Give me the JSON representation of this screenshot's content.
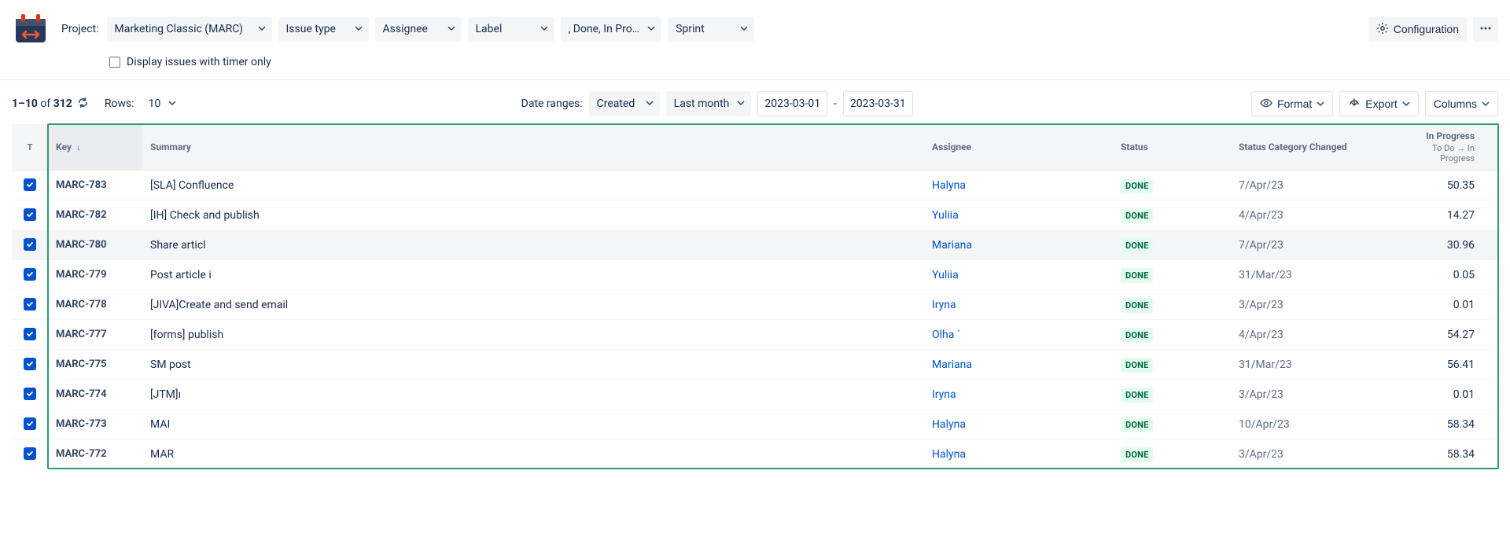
{
  "filters": {
    "project_label": "Project:",
    "project_value": "Marketing Classic (MARC)",
    "issue_type": "Issue type",
    "assignee": "Assignee",
    "label": "Label",
    "status_filter": ", Done, In Pro…",
    "sprint": "Sprint",
    "timer_only": "Display issues with timer only"
  },
  "actions": {
    "configuration": "Configuration"
  },
  "pagination": {
    "range": "1–10",
    "of_word": " of ",
    "total": "312",
    "rows_label": "Rows:",
    "rows_value": "10"
  },
  "date": {
    "ranges_label": "Date ranges:",
    "field": "Created",
    "preset": "Last month",
    "from": "2023-03-01",
    "sep": "-",
    "to": "2023-03-31"
  },
  "tools": {
    "format": "Format",
    "export": "Export",
    "columns": "Columns"
  },
  "headers": {
    "t": "T",
    "key": "Key",
    "summary": "Summary",
    "assignee": "Assignee",
    "status": "Status",
    "scc": "Status Category Changed",
    "inprog": "In Progress",
    "inprog_sub": "To Do → In Progress"
  },
  "rows": [
    {
      "key": "MARC-783",
      "summary": "[SLA] Confluence",
      "assignee": "Halyna",
      "status": "DONE",
      "scc": "7/Apr/23",
      "inprog": "50.35",
      "hovered": false
    },
    {
      "key": "MARC-782",
      "summary": "[IH] Check and publish",
      "assignee": "Yuliia",
      "status": "DONE",
      "scc": "4/Apr/23",
      "inprog": "14.27",
      "hovered": false
    },
    {
      "key": "MARC-780",
      "summary": "Share articl",
      "assignee": "Mariana",
      "status": "DONE",
      "scc": "7/Apr/23",
      "inprog": "30.96",
      "hovered": true
    },
    {
      "key": "MARC-779",
      "summary": "Post article i",
      "assignee": "Yuliia",
      "status": "DONE",
      "scc": "31/Mar/23",
      "inprog": "0.05",
      "hovered": false
    },
    {
      "key": "MARC-778",
      "summary": "[JIVA]Create and send email",
      "assignee": "Iryna",
      "status": "DONE",
      "scc": "3/Apr/23",
      "inprog": "0.01",
      "hovered": false
    },
    {
      "key": "MARC-777",
      "summary": "[forms] publish",
      "assignee": "Olha `",
      "status": "DONE",
      "scc": "4/Apr/23",
      "inprog": "54.27",
      "hovered": false
    },
    {
      "key": "MARC-775",
      "summary": "SM post",
      "assignee": "Mariana",
      "status": "DONE",
      "scc": "31/Mar/23",
      "inprog": "56.41",
      "hovered": false
    },
    {
      "key": "MARC-774",
      "summary": "[JTM]ı",
      "assignee": "Iryna",
      "status": "DONE",
      "scc": "3/Apr/23",
      "inprog": "0.01",
      "hovered": false
    },
    {
      "key": "MARC-773",
      "summary": "MAI",
      "assignee": "Halyna",
      "status": "DONE",
      "scc": "10/Apr/23",
      "inprog": "58.34",
      "hovered": false
    },
    {
      "key": "MARC-772",
      "summary": "MAR",
      "assignee": "Halyna",
      "status": "DONE",
      "scc": "3/Apr/23",
      "inprog": "58.34",
      "hovered": false
    }
  ]
}
